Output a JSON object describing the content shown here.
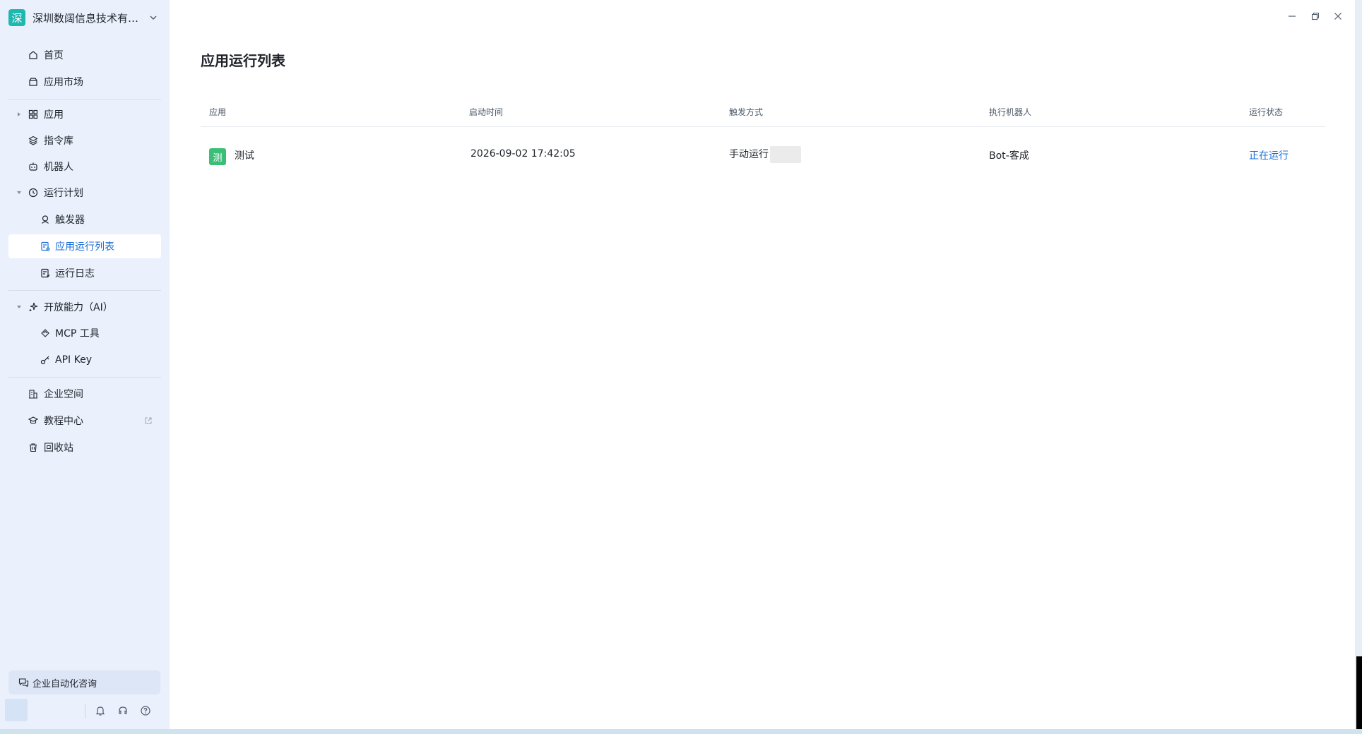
{
  "org": {
    "name": "深圳数阔信息技术有限...",
    "logo_char": "深"
  },
  "nav": {
    "home": "首页",
    "market": "应用市场",
    "apps": "应用",
    "commands": "指令库",
    "robots": "机器人",
    "plan": "运行计划",
    "triggers": "触发器",
    "run_list": "应用运行列表",
    "run_log": "运行日志",
    "open_ai": "开放能力（AI）",
    "mcp": "MCP 工具",
    "api_key": "API Key",
    "enterprise": "企业空间",
    "tutorial": "教程中心",
    "recycle": "回收站"
  },
  "consult": "企业自动化咨询",
  "page": {
    "title": "应用运行列表"
  },
  "table": {
    "headers": {
      "app": "应用",
      "start_time": "启动时间",
      "trigger": "触发方式",
      "robot": "执行机器人",
      "status": "运行状态"
    },
    "rows": [
      {
        "badge": "测",
        "app": "测试",
        "start_time": "2026-09-02 17:42:05",
        "trigger": "手动运行",
        "robot": "Bot-客成",
        "status": "正在运行"
      }
    ]
  },
  "colors": {
    "accent": "#1a6fd8",
    "sidebar_bg": "#eaf0fc",
    "badge_green": "#3bbf77",
    "org_logo": "#1fb8b0"
  }
}
